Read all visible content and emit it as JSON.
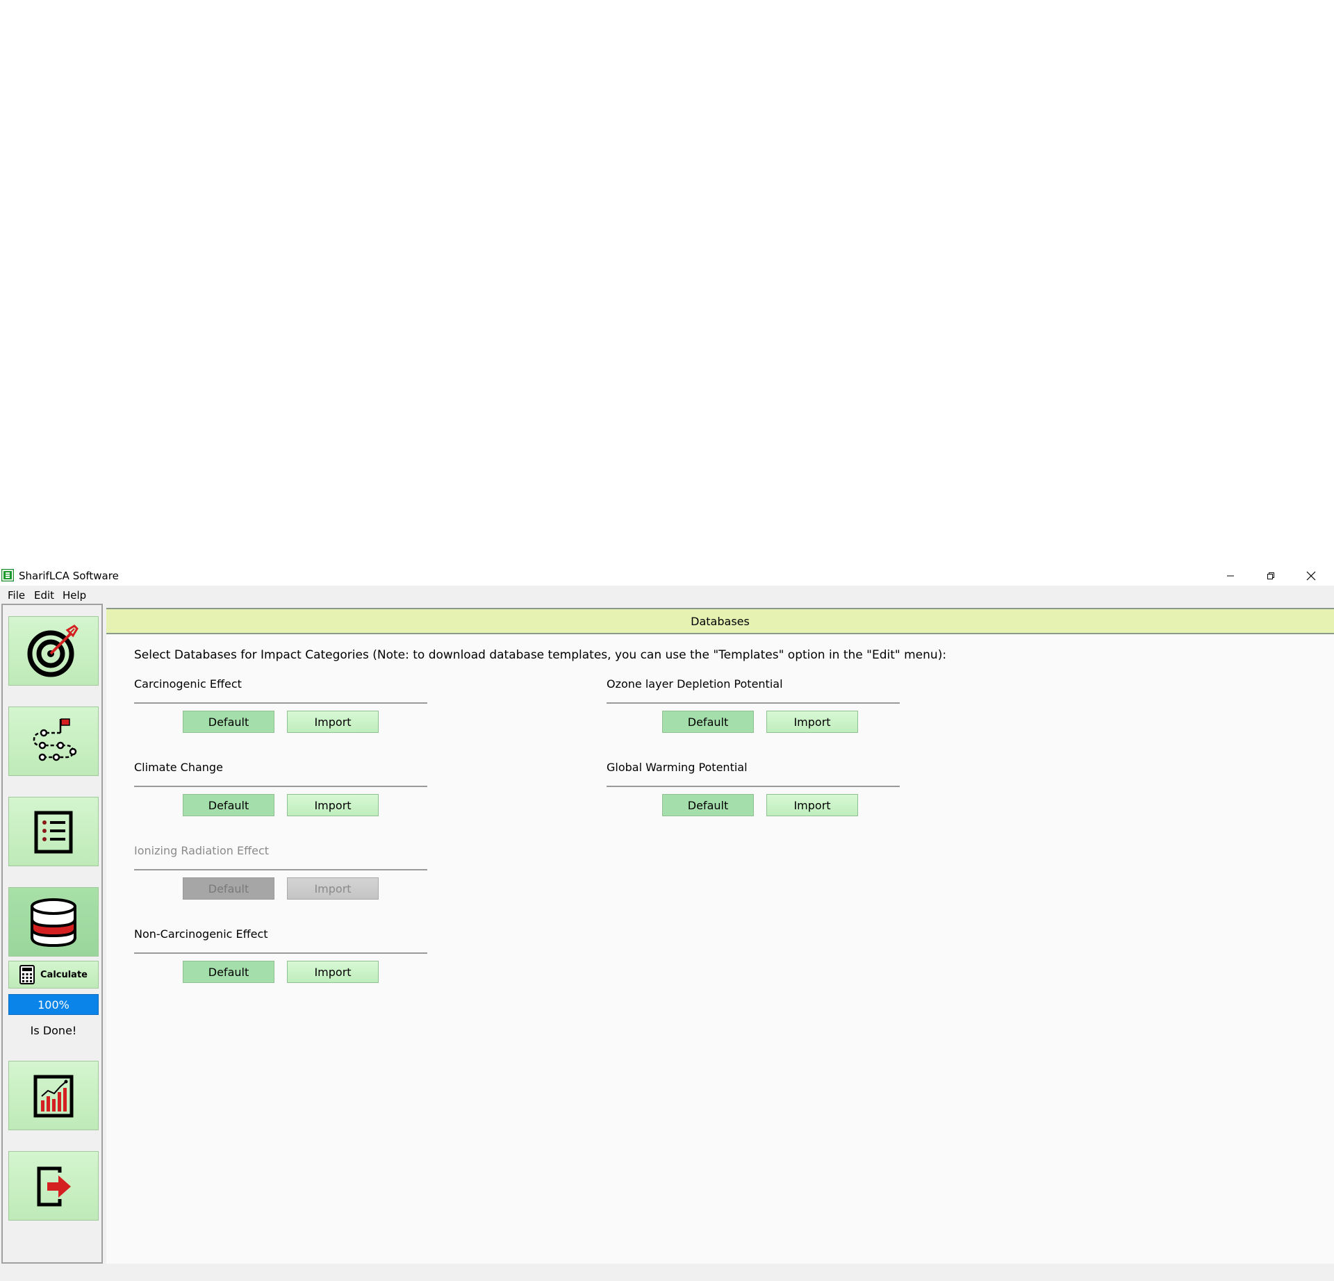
{
  "window": {
    "title": "SharifLCA Software",
    "icons": [
      "app-icon",
      "minimize-icon",
      "restore-icon",
      "close-icon"
    ]
  },
  "menu": {
    "items": [
      {
        "label": "File"
      },
      {
        "label": "Edit"
      },
      {
        "label": "Help"
      }
    ]
  },
  "sidebar": {
    "nav": [
      {
        "icon": "target-icon"
      },
      {
        "icon": "process-flow-icon"
      },
      {
        "icon": "list-icon"
      },
      {
        "icon": "database-icon",
        "active": true
      },
      {
        "icon": "report-chart-icon"
      },
      {
        "icon": "exit-icon"
      }
    ],
    "calculate_label": "Calculate",
    "progress": {
      "value": 100,
      "label": "100%"
    },
    "status": "Is Done!"
  },
  "main": {
    "header": "Databases",
    "instructions": "Select Databases for Impact Categories (Note: to download database templates, you can use the \"Templates\" option in the \"Edit\" menu):",
    "groups": [
      {
        "title": "Carcinogenic Effect",
        "default_label": "Default",
        "import_label": "Import",
        "enabled": true
      },
      {
        "title": "Ozone layer Depletion Potential",
        "default_label": "Default",
        "import_label": "Import",
        "enabled": true
      },
      {
        "title": "Climate Change",
        "default_label": "Default",
        "import_label": "Import",
        "enabled": true
      },
      {
        "title": "Global Warming Potential",
        "default_label": "Default",
        "import_label": "Import",
        "enabled": true
      },
      {
        "title": "Ionizing Radiation Effect",
        "default_label": "Default",
        "import_label": "Import",
        "enabled": false
      },
      {
        "title": "Non-Carcinogenic Effect",
        "default_label": "Default",
        "import_label": "Import",
        "enabled": true
      }
    ]
  },
  "colors": {
    "header_bg": "#e6f2b2",
    "button_green": "#a4deaa",
    "progress_blue": "#0a84e8",
    "accent_red": "#d42020"
  }
}
